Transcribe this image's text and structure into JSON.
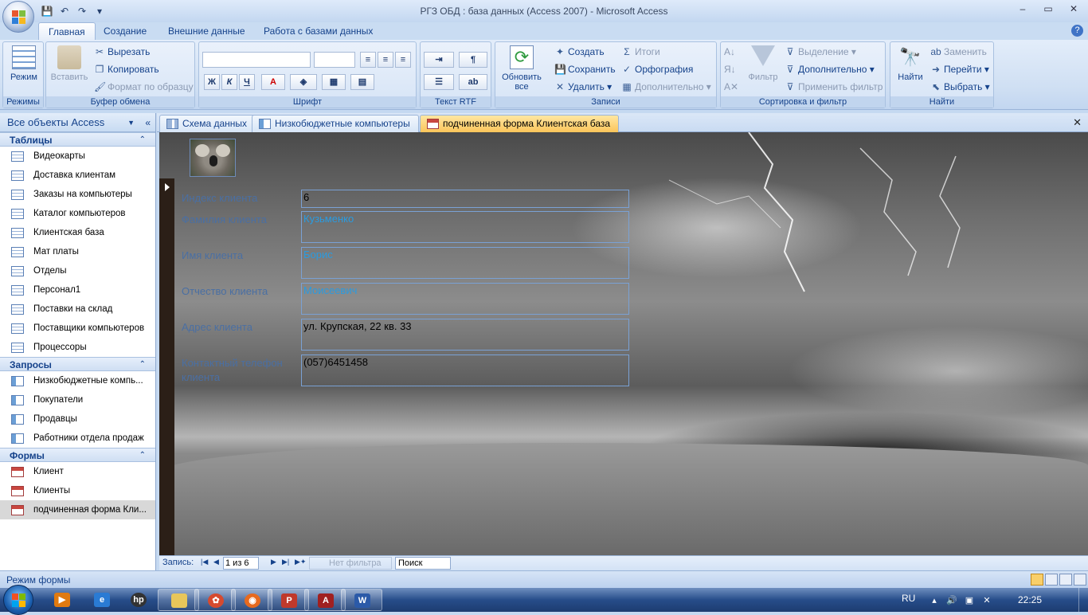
{
  "window": {
    "title": "РГЗ ОБД : база данных (Access 2007) - Microsoft Access",
    "minimize": "–",
    "maximize": "▭",
    "close": "✕"
  },
  "qat": {
    "save": "💾",
    "undo": "↶",
    "redo": "↷",
    "customize": "▾"
  },
  "ribbon_tabs": [
    "Главная",
    "Создание",
    "Внешние данные",
    "Работа с базами данных"
  ],
  "help": "?",
  "ribbon": {
    "modes": {
      "label": "Режимы",
      "view": "Режим"
    },
    "clipboard": {
      "label": "Буфер обмена",
      "paste": "Вставить",
      "cut": "Вырезать",
      "copy": "Копировать",
      "format_painter": "Формат по образцу"
    },
    "font": {
      "label": "Шрифт",
      "bold": "Ж",
      "italic": "К",
      "underline": "Ч",
      "color": "A"
    },
    "rtf": {
      "label": "Текст RTF"
    },
    "records": {
      "label": "Записи",
      "refresh": "Обновить все",
      "new": "Создать",
      "save": "Сохранить",
      "delete": "Удалить",
      "totals": "Итоги",
      "spelling": "Орфография",
      "more": "Дополнительно"
    },
    "sort": {
      "label": "Сортировка и фильтр",
      "filter": "Фильтр",
      "selection": "Выделение",
      "advanced": "Дополнительно",
      "apply": "Применить фильтр"
    },
    "find": {
      "label": "Найти",
      "find": "Найти",
      "replace": "Заменить",
      "goto": "Перейти",
      "select": "Выбрать"
    }
  },
  "nav": {
    "header": "Все объекты Access",
    "sections": [
      {
        "title": "Таблицы",
        "type": "tbl",
        "items": [
          "Видеокарты",
          "Доставка клиентам",
          "Заказы на компьютеры",
          "Каталог компьютеров",
          "Клиентская база",
          "Мат платы",
          "Отделы",
          "Персонал1",
          "Поставки на склад",
          "Поставщики компьютеров",
          "Процессоры"
        ]
      },
      {
        "title": "Запросы",
        "type": "qry",
        "items": [
          "Низкобюджетные компь...",
          "Покупатели",
          "Продавцы",
          "Работники отдела продаж"
        ]
      },
      {
        "title": "Формы",
        "type": "frm",
        "items": [
          "Клиент",
          "Клиенты",
          "подчиненная форма Кли..."
        ]
      }
    ]
  },
  "doc_tabs": [
    {
      "label": "Схема данных",
      "type": "rel"
    },
    {
      "label": "Низкобюджетные компьютеры",
      "type": "qry"
    },
    {
      "label": "подчиненная форма Клиентская база",
      "type": "frm"
    }
  ],
  "form": {
    "fields": [
      {
        "label": "Индекс клиента",
        "value": "6"
      },
      {
        "label": "Фамилия клиента",
        "value": "Кузьменко"
      },
      {
        "label": "Имя клиента",
        "value": "Борис"
      },
      {
        "label": "Отчество клиента",
        "value": "Моисеевич"
      },
      {
        "label": "Адрес клиента",
        "value": "ул. Крупская, 22 кв. 33"
      },
      {
        "label": "Контактный телефон клиента",
        "value": "(057)6451458"
      }
    ]
  },
  "record_nav": {
    "label": "Запись:",
    "current": "1 из 6",
    "no_filter": "Нет фильтра",
    "search": "Поиск"
  },
  "status": {
    "text": "Режим формы"
  },
  "taskbar": {
    "lang": "RU",
    "time": "22:25"
  },
  "colors": {
    "accent": "#15428b",
    "tab_active": "#fbc55a",
    "field_blue": "#2a9be0"
  }
}
